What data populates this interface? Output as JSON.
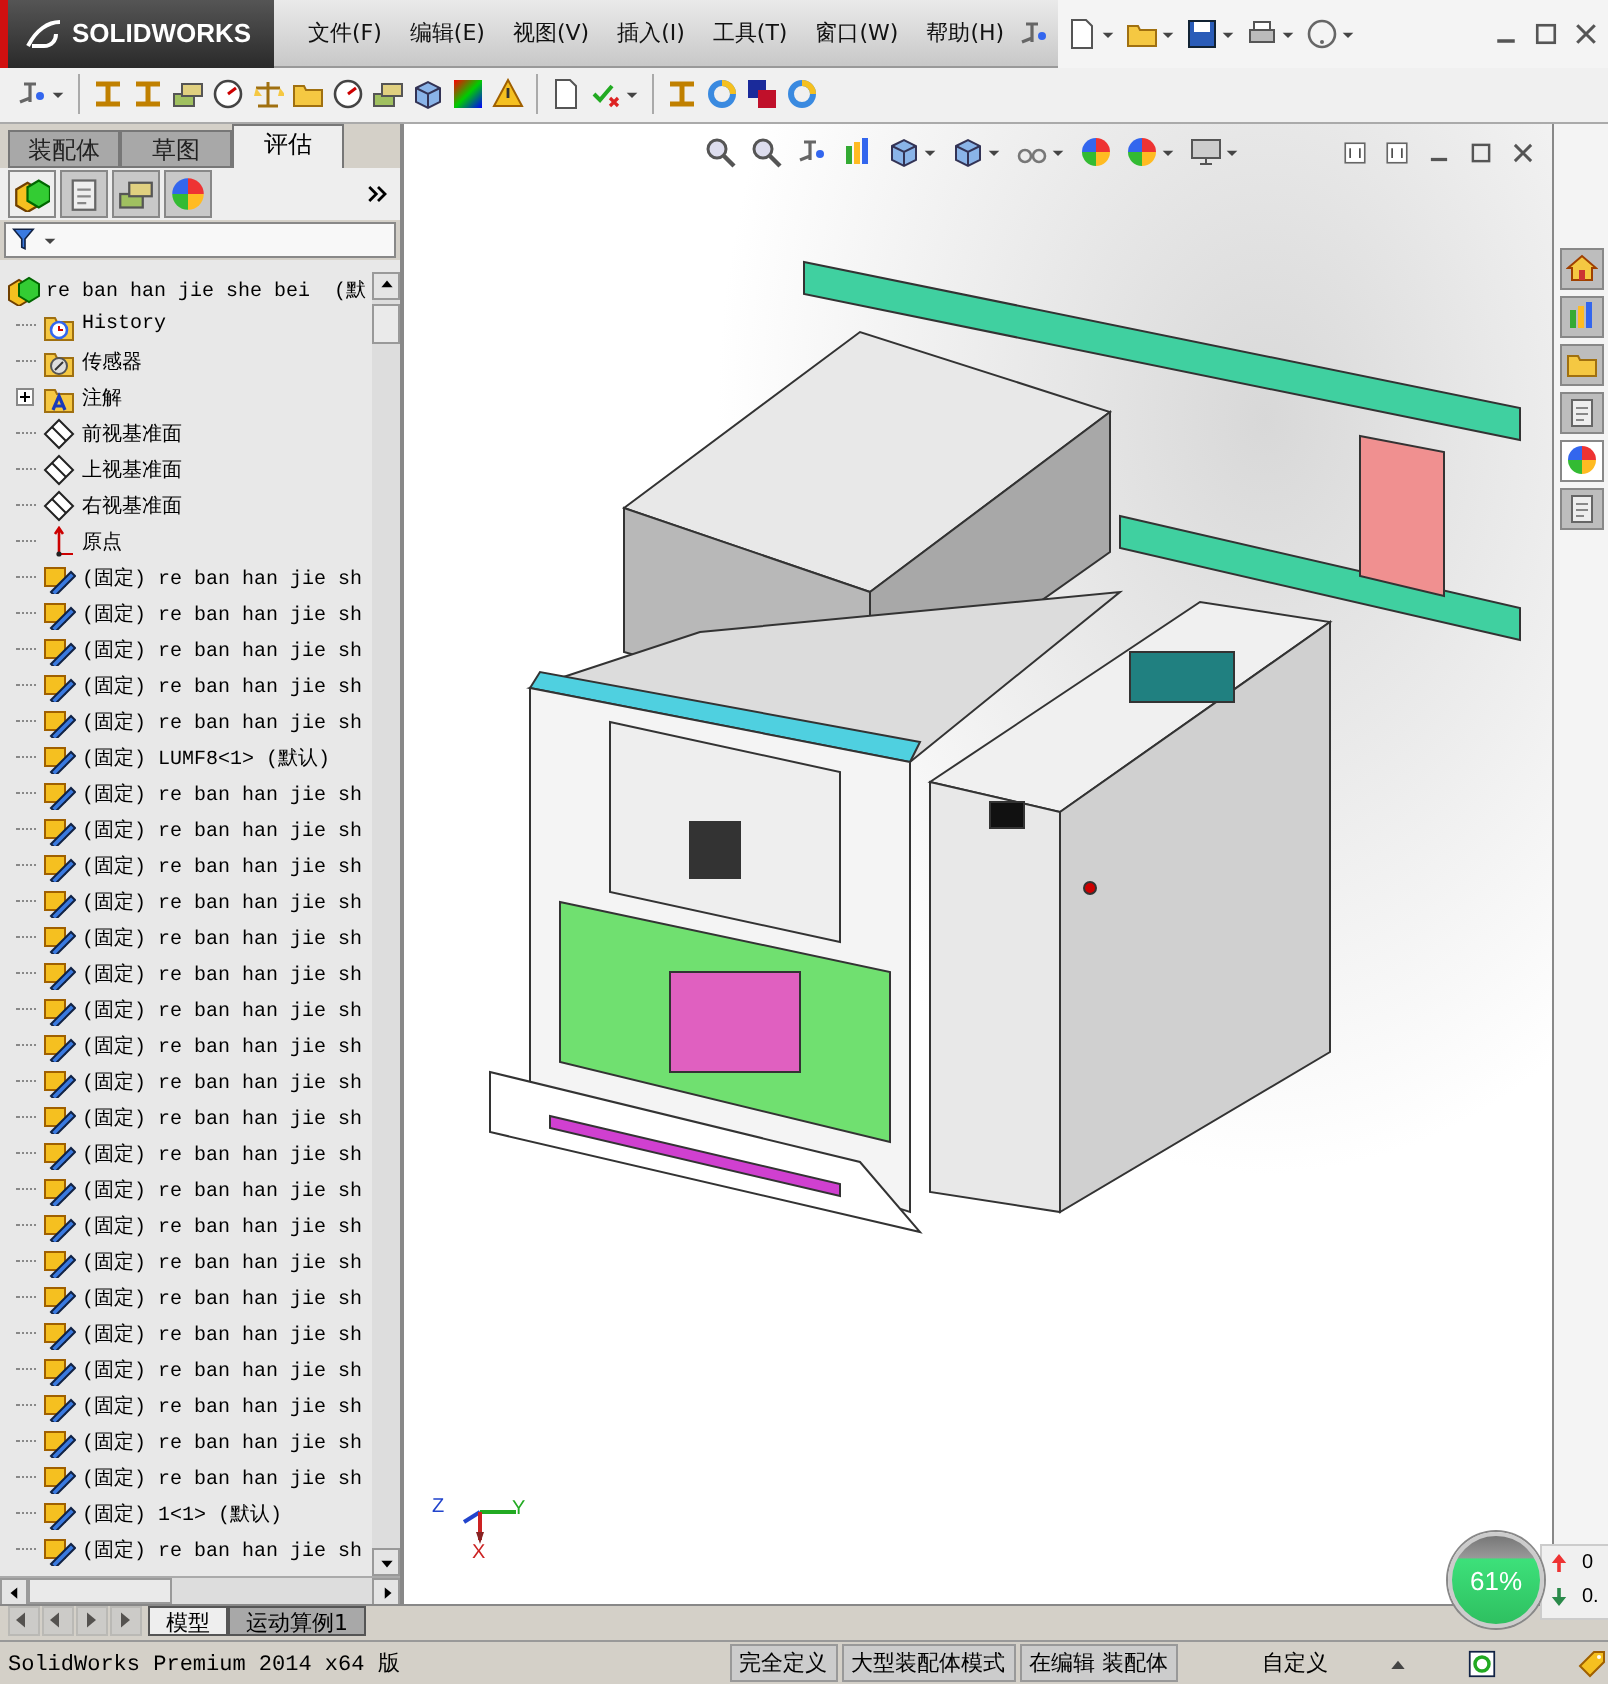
{
  "window": {
    "logo": "SOLIDWORKS"
  },
  "menu": [
    {
      "label": "文件(F)"
    },
    {
      "label": "编辑(E)"
    },
    {
      "label": "视图(V)"
    },
    {
      "label": "插入(I)"
    },
    {
      "label": "工具(T)"
    },
    {
      "label": "窗口(W)"
    },
    {
      "label": "帮助(H)"
    }
  ],
  "panel_tabs": [
    {
      "label": "装配体",
      "selected": false
    },
    {
      "label": "草图",
      "selected": false
    },
    {
      "label": "评估",
      "selected": true
    }
  ],
  "tree": {
    "label": "re ban han jie she bei  (默",
    "children": [
      {
        "kind": "history",
        "label": "History"
      },
      {
        "kind": "sensors",
        "label": "传感器"
      },
      {
        "kind": "annotations",
        "label": "注解",
        "expanded": false
      },
      {
        "kind": "plane",
        "label": "前视基准面"
      },
      {
        "kind": "plane",
        "label": "上视基准面"
      },
      {
        "kind": "plane",
        "label": "右视基准面"
      },
      {
        "kind": "origin",
        "label": "原点"
      },
      {
        "kind": "part",
        "label": "(固定) re ban han jie sh"
      },
      {
        "kind": "part",
        "label": "(固定) re ban han jie sh"
      },
      {
        "kind": "part",
        "label": "(固定) re ban han jie sh"
      },
      {
        "kind": "part",
        "label": "(固定) re ban han jie sh"
      },
      {
        "kind": "part",
        "label": "(固定) re ban han jie sh"
      },
      {
        "kind": "part",
        "label": "(固定) LUMF8<1> (默认)"
      },
      {
        "kind": "part",
        "label": "(固定) re ban han jie sh"
      },
      {
        "kind": "part",
        "label": "(固定) re ban han jie sh"
      },
      {
        "kind": "part",
        "label": "(固定) re ban han jie sh"
      },
      {
        "kind": "part",
        "label": "(固定) re ban han jie sh"
      },
      {
        "kind": "part",
        "label": "(固定) re ban han jie sh"
      },
      {
        "kind": "part",
        "label": "(固定) re ban han jie sh"
      },
      {
        "kind": "part",
        "label": "(固定) re ban han jie sh"
      },
      {
        "kind": "part",
        "label": "(固定) re ban han jie sh"
      },
      {
        "kind": "part",
        "label": "(固定) re ban han jie sh"
      },
      {
        "kind": "part",
        "label": "(固定) re ban han jie sh"
      },
      {
        "kind": "part",
        "label": "(固定) re ban han jie sh"
      },
      {
        "kind": "part",
        "label": "(固定) re ban han jie sh"
      },
      {
        "kind": "part",
        "label": "(固定) re ban han jie sh"
      },
      {
        "kind": "part",
        "label": "(固定) re ban han jie sh"
      },
      {
        "kind": "part",
        "label": "(固定) re ban han jie sh"
      },
      {
        "kind": "part",
        "label": "(固定) re ban han jie sh"
      },
      {
        "kind": "part",
        "label": "(固定) re ban han jie sh"
      },
      {
        "kind": "part",
        "label": "(固定) re ban han jie sh"
      },
      {
        "kind": "part",
        "label": "(固定) re ban han jie sh"
      },
      {
        "kind": "part",
        "label": "(固定) re ban han jie sh"
      },
      {
        "kind": "part",
        "label": "(固定) 1<1> (默认)"
      },
      {
        "kind": "part",
        "label": "(固定) re ban han jie sh"
      }
    ]
  },
  "bottom_tabs": [
    {
      "label": "模型",
      "selected": true
    },
    {
      "label": "运动算例1",
      "selected": false
    }
  ],
  "viewport": {
    "triad": {
      "x": "X",
      "y": "Y",
      "z": "Z"
    },
    "performance": {
      "reading": "61%",
      "up": "0",
      "down": "0."
    }
  },
  "status_bar": {
    "product": "SolidWorks Premium 2014 x64 版",
    "fields": [
      {
        "label": "完全定义"
      },
      {
        "label": "大型装配体模式"
      },
      {
        "label": "在编辑 装配体"
      }
    ],
    "units": "自定义"
  }
}
